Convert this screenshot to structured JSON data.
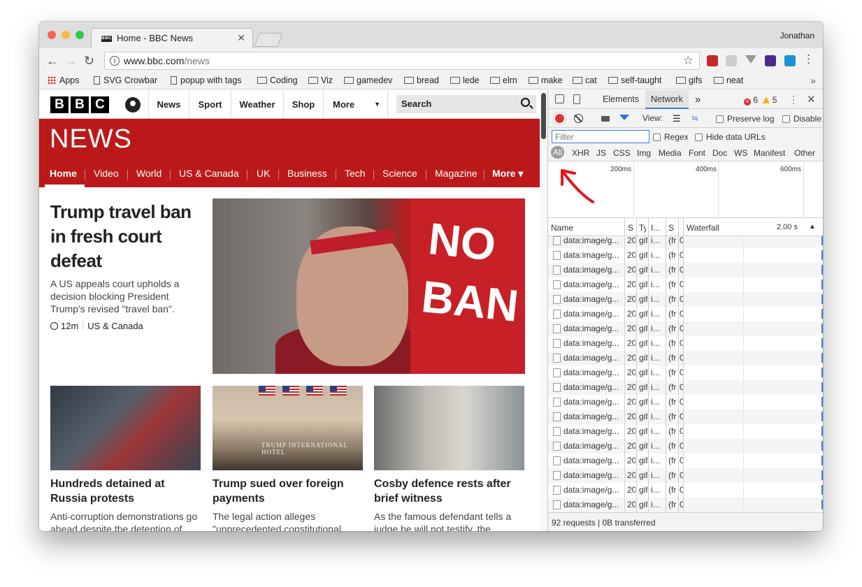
{
  "window": {
    "user": "Jonathan",
    "tab_title": "Home - BBC News",
    "tab_favicon": "BBC"
  },
  "toolbar": {
    "url_host": "www.bbc.com",
    "url_path": "/news",
    "icons": [
      "back-icon",
      "forward-icon",
      "reload-icon",
      "info-icon",
      "star-icon"
    ]
  },
  "bookmarks": {
    "items": [
      {
        "label": "Apps",
        "icon": "apps-grid-icon"
      },
      {
        "label": "SVG Crowbar",
        "icon": "page-icon"
      },
      {
        "label": "popup with tags",
        "icon": "page-icon"
      },
      {
        "label": "Coding",
        "icon": "folder-icon"
      },
      {
        "label": "Viz",
        "icon": "folder-icon"
      },
      {
        "label": "gamedev",
        "icon": "folder-icon"
      },
      {
        "label": "bread",
        "icon": "folder-icon"
      },
      {
        "label": "lede",
        "icon": "folder-icon"
      },
      {
        "label": "elrn",
        "icon": "folder-icon"
      },
      {
        "label": "make",
        "icon": "folder-icon"
      },
      {
        "label": "cat",
        "icon": "folder-icon"
      },
      {
        "label": "self-taught",
        "icon": "folder-icon"
      },
      {
        "label": "gifs",
        "icon": "folder-icon"
      },
      {
        "label": "neat",
        "icon": "folder-icon"
      }
    ],
    "more": "»"
  },
  "bbc": {
    "logo": [
      "B",
      "B",
      "C"
    ],
    "topnav": [
      "News",
      "Sport",
      "Weather",
      "Shop",
      "More"
    ],
    "search_label": "Search",
    "banner_title": "NEWS",
    "newsnav": [
      "Home",
      "Video",
      "World",
      "US & Canada",
      "UK",
      "Business",
      "Tech",
      "Science",
      "Magazine",
      "More ▾"
    ]
  },
  "lead": {
    "headline": "Trump travel ban in fresh court defeat",
    "summary": "A US appeals court upholds a decision blocking President Trump's revised \"travel ban\".",
    "time": "12m",
    "section": "US & Canada",
    "sign_line1": "NO",
    "sign_line2": "BAN"
  },
  "cards": [
    {
      "title": "Hundreds detained at Russia protests",
      "summary": "Anti-corruption demonstrations go ahead despite the detention of"
    },
    {
      "title": "Trump sued over foreign payments",
      "summary": "The legal action alleges \"unprecedented constitutional",
      "image_text": "TRUMP INTERNATIONAL HOTEL"
    },
    {
      "title": "Cosby defence rests after brief witness",
      "summary": "As the famous defendant tells a judge he will not testify, the"
    }
  ],
  "devtools": {
    "tabs": [
      "Elements",
      "Network",
      "»"
    ],
    "errors": "6",
    "warnings": "5",
    "view_label": "View:",
    "preserve_log": "Preserve log",
    "disable_cache": "Disable",
    "filter_placeholder": "Filter",
    "regex": "Regex",
    "hide_data_urls": "Hide data URLs",
    "type_filters": [
      "All",
      "XHR",
      "JS",
      "CSS",
      "Img",
      "Media",
      "Font",
      "Doc",
      "WS",
      "Manifest",
      "Other"
    ],
    "timeline_labels": [
      "200ms",
      "400ms",
      "600ms"
    ],
    "columns": [
      "Name",
      "S",
      "Ty",
      "I...",
      "S",
      "Waterfall",
      "2.00 s"
    ],
    "row_values": [
      "data:image/g...",
      "20",
      "gif",
      "i...",
      "(fr",
      "0"
    ],
    "row_count_visible": 19,
    "status": "92 requests | 0B transferred"
  },
  "colors": {
    "bbc_red": "#bb1919",
    "devtools_blue": "#3a7fe0",
    "annotation_arrow": "#e8141a"
  }
}
